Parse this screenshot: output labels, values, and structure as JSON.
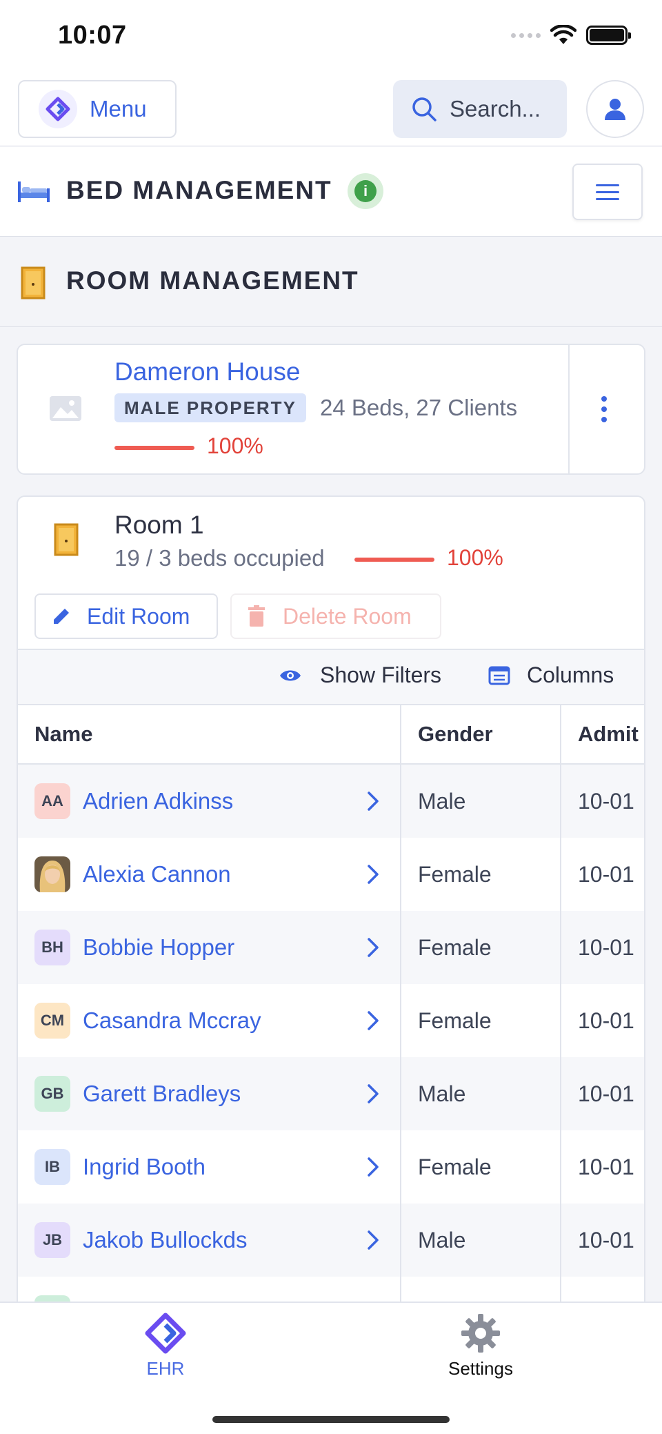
{
  "status_bar": {
    "time": "10:07"
  },
  "top_bar": {
    "menu_label": "Menu",
    "search_placeholder": "Search..."
  },
  "bed_section": {
    "title": "BED MANAGEMENT",
    "info": "i"
  },
  "room_section": {
    "title": "ROOM MANAGEMENT"
  },
  "property": {
    "name": "Dameron House",
    "badge": "MALE PROPERTY",
    "stats": "24 Beds, 27 Clients",
    "occupancy_pct": "100%",
    "occupancy_fraction": 1.0
  },
  "room": {
    "name": "Room 1",
    "occupancy_text": "19 / 3 beds occupied",
    "occupancy_pct": "100%",
    "occupancy_fraction": 1.0,
    "edit_label": "Edit Room",
    "delete_label": "Delete Room"
  },
  "filters": {
    "show_filters": "Show Filters",
    "columns": "Columns"
  },
  "table": {
    "headers": [
      "Name",
      "Gender",
      "Admit"
    ],
    "rows": [
      {
        "initials": "AA",
        "avatar_color": "#fbd3cf",
        "name": "Adrien Adkinss",
        "gender": "Male",
        "admit": "10-01"
      },
      {
        "initials": "",
        "avatar_color": "#f1c48a",
        "name": "Alexia Cannon",
        "gender": "Female",
        "admit": "10-01",
        "photo": true
      },
      {
        "initials": "BH",
        "avatar_color": "#e4dcfb",
        "name": "Bobbie Hopper",
        "gender": "Female",
        "admit": "10-01"
      },
      {
        "initials": "CM",
        "avatar_color": "#fde6c4",
        "name": "Casandra Mccray",
        "gender": "Female",
        "admit": "10-01"
      },
      {
        "initials": "GB",
        "avatar_color": "#cdeedb",
        "name": "Garett Bradleys",
        "gender": "Male",
        "admit": "10-01"
      },
      {
        "initials": "IB",
        "avatar_color": "#dbe5fb",
        "name": "Ingrid Booth",
        "gender": "Female",
        "admit": "10-01"
      },
      {
        "initials": "JB",
        "avatar_color": "#e4dcfb",
        "name": "Jakob Bullockds",
        "gender": "Male",
        "admit": "10-01"
      },
      {
        "initials": "",
        "avatar_color": "#cdeedb",
        "name": "",
        "gender": "",
        "admit": ""
      }
    ]
  },
  "bottom_nav": {
    "ehr_label": "EHR",
    "settings_label": "Settings"
  },
  "colors": {
    "accent": "#3a64e0",
    "danger": "#e2433a",
    "brand": "#6a4cf0"
  }
}
